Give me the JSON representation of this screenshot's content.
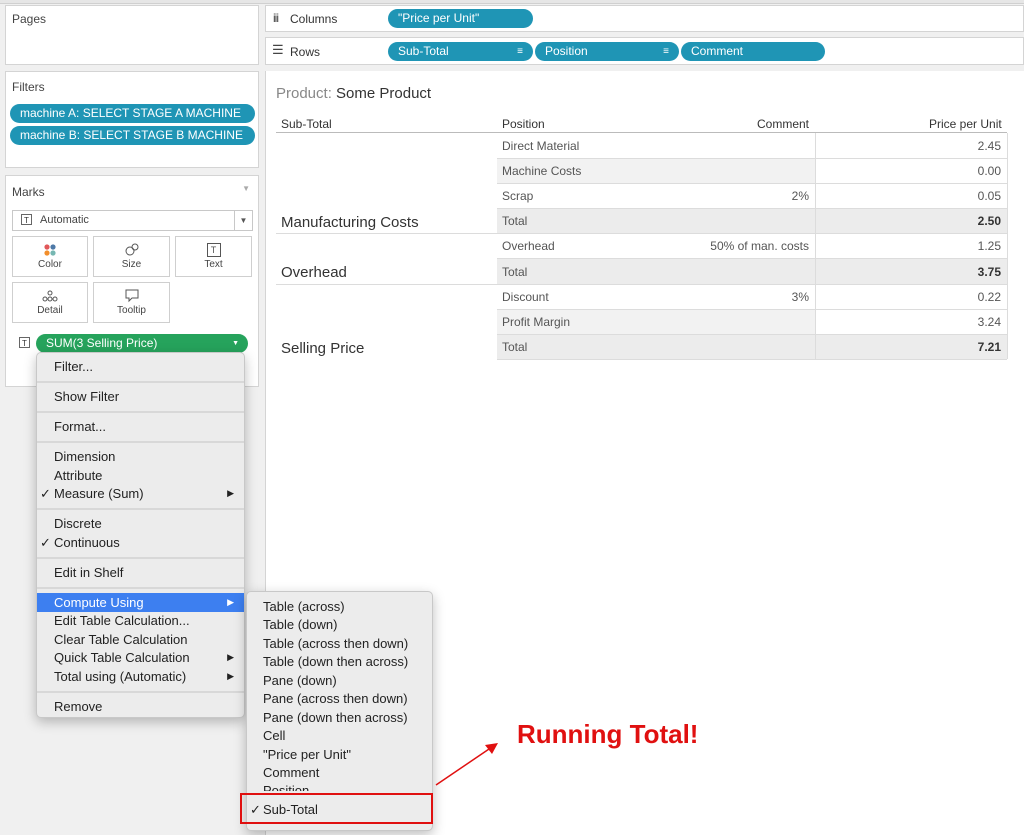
{
  "pages": {
    "title": "Pages"
  },
  "filters": {
    "title": "Filters",
    "items": [
      "machine A: SELECT STAGE A MACHINE",
      "machine B: SELECT STAGE B MACHINE"
    ]
  },
  "marks": {
    "title": "Marks",
    "mark_type": "Automatic",
    "cards": [
      {
        "label": "Color",
        "icon": "color-icon"
      },
      {
        "label": "Size",
        "icon": "size-icon"
      },
      {
        "label": "Text",
        "icon": "text-icon"
      },
      {
        "label": "Detail",
        "icon": "detail-icon"
      },
      {
        "label": "Tooltip",
        "icon": "tooltip-icon"
      }
    ],
    "field_pill": "SUM(3 Selling Price)"
  },
  "shelves": {
    "columns": {
      "label": "Columns",
      "pills": [
        "\"Price per Unit\""
      ]
    },
    "rows": {
      "label": "Rows",
      "pills": [
        "Sub-Total",
        "Position",
        "Comment"
      ]
    }
  },
  "view": {
    "title_prefix": "Product:",
    "title_value": "Some Product",
    "headers": [
      "Sub-Total",
      "Position",
      "Comment",
      "Price per Unit"
    ],
    "groups": [
      "Manufacturing Costs",
      "Overhead",
      "Selling Price"
    ],
    "rows": [
      {
        "position": "Direct Material",
        "comment": "",
        "price": "2.45"
      },
      {
        "position": "Machine Costs",
        "comment": "",
        "price": "0.00"
      },
      {
        "position": "Scrap",
        "comment": "2%",
        "price": "0.05"
      },
      {
        "position": "Total",
        "comment": "",
        "price": "2.50"
      },
      {
        "position": "Overhead",
        "comment": "50% of man. costs",
        "price": "1.25"
      },
      {
        "position": "Total",
        "comment": "",
        "price": "3.75"
      },
      {
        "position": "Discount",
        "comment": "3%",
        "price": "0.22"
      },
      {
        "position": "Profit Margin",
        "comment": "",
        "price": "3.24"
      },
      {
        "position": "Total",
        "comment": "",
        "price": "7.21"
      }
    ]
  },
  "context_menu": {
    "items": [
      "Filter...",
      "Show Filter",
      "Format...",
      "Dimension",
      "Attribute",
      "Measure (Sum)",
      "Discrete",
      "Continuous",
      "Edit in Shelf",
      "Compute Using",
      "Edit Table Calculation...",
      "Clear Table Calculation",
      "Quick Table Calculation",
      "Total using (Automatic)",
      "Remove"
    ],
    "checked": [
      "Measure (Sum)",
      "Continuous"
    ],
    "highlighted": "Compute Using"
  },
  "submenu": {
    "items": [
      "Table (across)",
      "Table (down)",
      "Table (across then down)",
      "Table (down then across)",
      "Pane (down)",
      "Pane (across then down)",
      "Pane (down then across)",
      "Cell",
      "\"Price per Unit\"",
      "Comment",
      "Position",
      "Sub-Total"
    ],
    "checked": "Sub-Total"
  },
  "annotation": {
    "text": "Running Total!",
    "color": "#e01010"
  },
  "colors": {
    "pill_blue": "#1f95b5",
    "pill_green": "#26a35c",
    "menu_highlight": "#3d7ff0"
  }
}
